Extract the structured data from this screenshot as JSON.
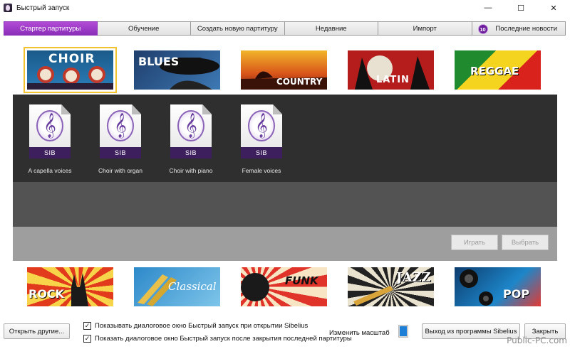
{
  "window": {
    "title": "Быстрый запуск",
    "controls": [
      "—",
      "☐",
      "✕"
    ]
  },
  "tabs": [
    {
      "label": "Стартер партитуры",
      "active": true
    },
    {
      "label": "Обучение"
    },
    {
      "label": "Создать новую партитуру"
    },
    {
      "label": "Недавние"
    },
    {
      "label": "Импорт"
    },
    {
      "label": "Последние новости",
      "badge": "10"
    }
  ],
  "genres_top": [
    {
      "label": "CHOIR",
      "selected": true
    },
    {
      "label": "BLUES"
    },
    {
      "label": "COUNTRY"
    },
    {
      "label": "LATIN"
    },
    {
      "label": "REGGAE"
    }
  ],
  "genres_bottom": [
    {
      "label": "ROCK"
    },
    {
      "label": "Classical"
    },
    {
      "label": "FUNK"
    },
    {
      "label": "JAZZ"
    },
    {
      "label": "POP"
    }
  ],
  "files": [
    {
      "name": "A capella voices",
      "type": "SIB"
    },
    {
      "name": "Choir with organ",
      "type": "SIB"
    },
    {
      "name": "Choir with piano",
      "type": "SIB"
    },
    {
      "name": "Female voices",
      "type": "SIB"
    }
  ],
  "panel_buttons": {
    "play": "Играть",
    "select": "Выбрать"
  },
  "footer": {
    "open_other": "Открыть другие...",
    "check_show_on_open": "Показывать диалоговое окно Быстрый запуск при открытии Sibelius",
    "check_show_after_close": "Показать диалоговое окно Быстрый запуск после закрытия последней партитуры",
    "zoom_label": "Изменить масштаб",
    "exit": "Выход из программы Sibelius",
    "close": "Закрыть"
  },
  "watermark": "Public-PC.com",
  "colors": {
    "active_tab": "#a040cc",
    "selected_outline": "#f3c230",
    "zoom_accent": "#1e7fd6"
  }
}
